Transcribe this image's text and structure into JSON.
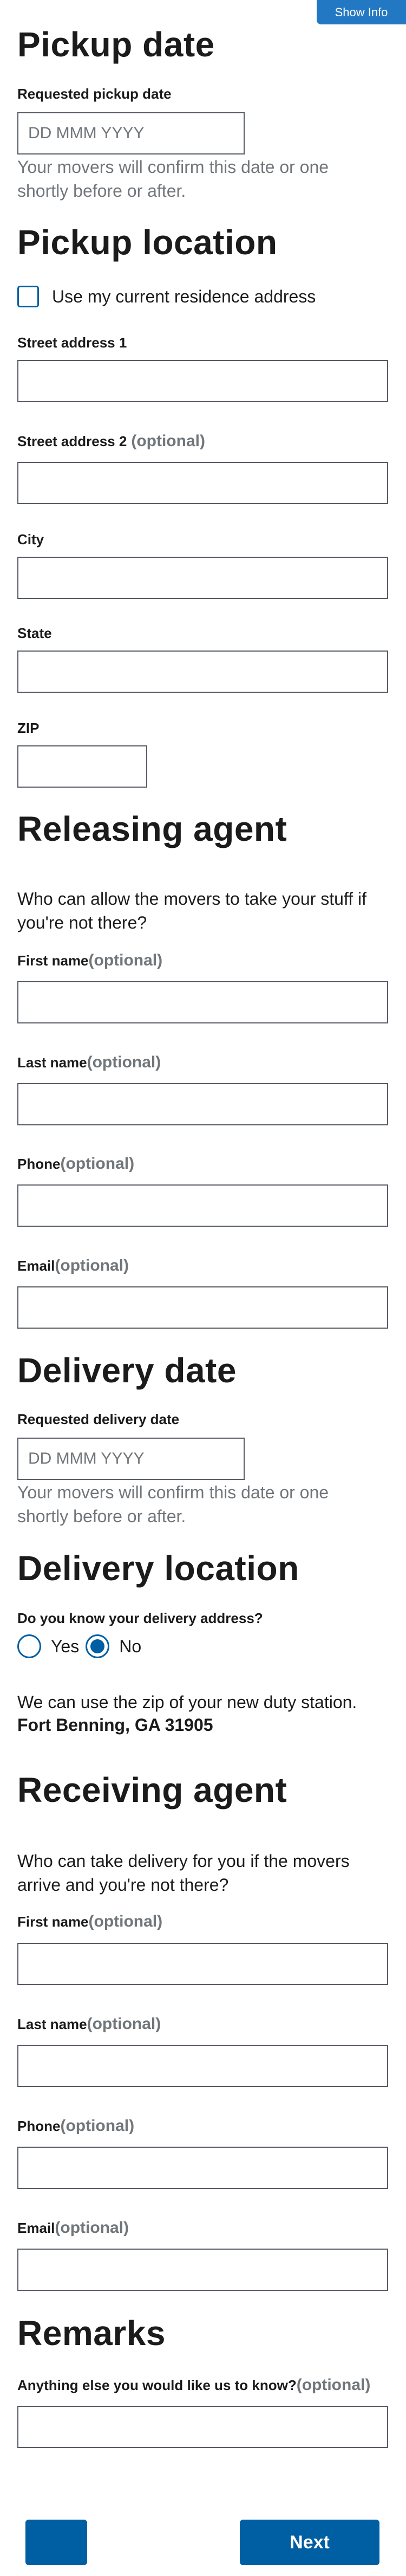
{
  "header": {
    "show_info": "Show Info"
  },
  "pickup_date": {
    "title": "Pickup date",
    "label": "Requested pickup date",
    "placeholder": "DD MMM YYYY",
    "hint": "Your movers will confirm this date or one shortly before or after."
  },
  "pickup_location": {
    "title": "Pickup location",
    "checkbox_label": "Use my current residence address",
    "street1_label": "Street address 1",
    "street2_label": "Street address 2",
    "optional": "(optional)",
    "city_label": "City",
    "state_label": "State",
    "zip_label": "ZIP"
  },
  "releasing_agent": {
    "title": "Releasing agent",
    "description": "Who can allow the movers to take your stuff if you're not there?",
    "first_name": "First name",
    "last_name": "Last name",
    "phone": "Phone",
    "email": "Email",
    "optional": "(optional)"
  },
  "delivery_date": {
    "title": "Delivery date",
    "label": "Requested delivery date",
    "placeholder": "DD MMM YYYY",
    "hint": "Your movers will confirm this date or one shortly before or after."
  },
  "delivery_location": {
    "title": "Delivery location",
    "question": "Do you know your delivery address?",
    "yes": "Yes",
    "no": "No",
    "selected": "No",
    "note": "We can use the zip of your new duty station.",
    "duty_station": "Fort Benning, GA 31905"
  },
  "receiving_agent": {
    "title": "Receiving agent",
    "description": "Who can take delivery for you if the movers arrive and you're not there?",
    "first_name": "First name",
    "last_name": "Last name",
    "phone": "Phone",
    "email": "Email",
    "optional": "(optional)"
  },
  "remarks": {
    "title": "Remarks",
    "label": "Anything else you would like us to know?",
    "optional": "(optional)"
  },
  "footer": {
    "back_label": "",
    "next_label": "Next"
  },
  "colors": {
    "primary": "#005ea2",
    "info": "#2378c3",
    "hint": "#71767a",
    "border": "#565c65"
  }
}
